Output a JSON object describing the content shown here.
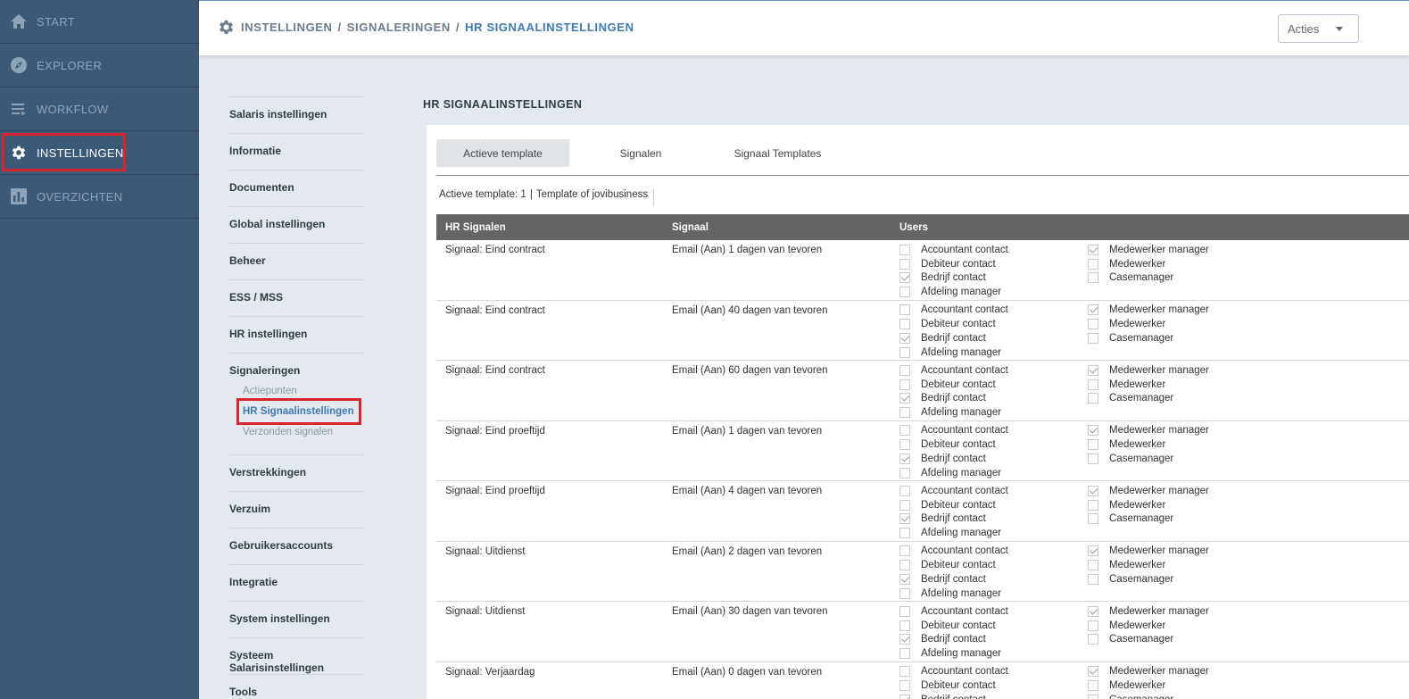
{
  "nav": {
    "items": [
      {
        "label": "START",
        "icon": "home-icon"
      },
      {
        "label": "EXPLORER",
        "icon": "compass-icon"
      },
      {
        "label": "WORKFLOW",
        "icon": "list-icon"
      },
      {
        "label": "INSTELLINGEN",
        "icon": "gear-icon",
        "active": true
      },
      {
        "label": "OVERZICHTEN",
        "icon": "chart-icon"
      }
    ]
  },
  "header": {
    "breadcrumb": [
      "INSTELLINGEN",
      "SIGNALERINGEN",
      "HR SIGNAALINSTELLINGEN"
    ],
    "separator": "/",
    "actions_label": "Acties"
  },
  "settings_menu": {
    "groups": [
      {
        "label": "Salaris instellingen"
      },
      {
        "label": "Informatie"
      },
      {
        "label": "Documenten"
      },
      {
        "label": "Global instellingen"
      },
      {
        "label": "Beheer"
      },
      {
        "label": "ESS / MSS"
      },
      {
        "label": "HR instellingen"
      },
      {
        "label": "Signaleringen",
        "children": [
          "Actiepunten",
          "HR Signaalinstellingen",
          "Verzonden signalen"
        ],
        "current_child": "HR Signaalinstellingen"
      },
      {
        "label": "Verstrekkingen"
      },
      {
        "label": "Verzuim"
      },
      {
        "label": "Gebruikersaccounts"
      },
      {
        "label": "Integratie"
      },
      {
        "label": "System instellingen"
      },
      {
        "label": "Systeem Salarisinstellingen"
      },
      {
        "label": "Tools"
      }
    ]
  },
  "main": {
    "heading": "HR SIGNAALINSTELLINGEN",
    "tabs": [
      {
        "label": "Actieve template",
        "active": true
      },
      {
        "label": "Signalen"
      },
      {
        "label": "Signaal Templates"
      }
    ],
    "active_template": {
      "label": "Actieve template: 1",
      "name": "Template of jovibusiness"
    },
    "table": {
      "headers": [
        "HR Signalen",
        "Signaal",
        "Users"
      ],
      "user_labels": [
        "Accountant contact",
        "Debiteur contact",
        "Bedrijf contact",
        "Afdeling manager",
        "Medewerker manager",
        "Medewerker",
        "Casemanager"
      ],
      "rows": [
        {
          "signal": "Signaal: Eind contract",
          "channel": "Email (Aan) 1 dagen van tevoren",
          "checked": [
            false,
            false,
            true,
            false,
            true,
            false,
            false
          ]
        },
        {
          "signal": "Signaal: Eind contract",
          "channel": "Email (Aan) 40 dagen van tevoren",
          "checked": [
            false,
            false,
            true,
            false,
            true,
            false,
            false
          ]
        },
        {
          "signal": "Signaal: Eind contract",
          "channel": "Email (Aan) 60 dagen van tevoren",
          "checked": [
            false,
            false,
            true,
            false,
            true,
            false,
            false
          ]
        },
        {
          "signal": "Signaal: Eind proeftijd",
          "channel": "Email (Aan) 1 dagen van tevoren",
          "checked": [
            false,
            false,
            true,
            false,
            true,
            false,
            false
          ]
        },
        {
          "signal": "Signaal: Eind proeftijd",
          "channel": "Email (Aan) 4 dagen van tevoren",
          "checked": [
            false,
            false,
            true,
            false,
            true,
            false,
            false
          ]
        },
        {
          "signal": "Signaal: Uitdienst",
          "channel": "Email (Aan) 2 dagen van tevoren",
          "checked": [
            false,
            false,
            true,
            false,
            true,
            false,
            false
          ]
        },
        {
          "signal": "Signaal: Uitdienst",
          "channel": "Email (Aan) 30 dagen van tevoren",
          "checked": [
            false,
            false,
            true,
            false,
            true,
            false,
            false
          ]
        },
        {
          "signal": "Signaal: Verjaardag",
          "channel": "Email (Aan) 0 dagen van tevoren",
          "checked": [
            false,
            false,
            true,
            false,
            true,
            false,
            false
          ]
        }
      ]
    }
  },
  "colors": {
    "sidebar": "#3b5a78",
    "accent": "#3f7ab0",
    "highlight": "#d9232d",
    "table_header": "#656565"
  }
}
